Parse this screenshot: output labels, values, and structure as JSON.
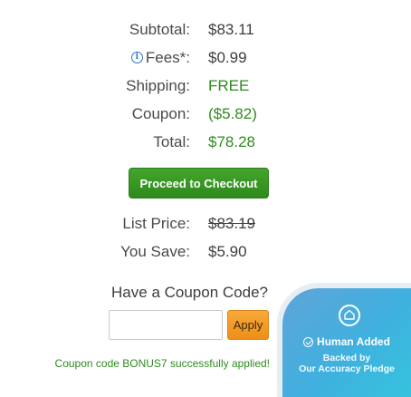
{
  "summary": {
    "subtotal": {
      "label": "Subtotal:",
      "value": "$83.11"
    },
    "fees": {
      "icon": "info-icon",
      "icon_glyph": "i",
      "label": "Fees*:",
      "value": "$0.99"
    },
    "shipping": {
      "label": "Shipping:",
      "value": "FREE"
    },
    "coupon": {
      "label": "Coupon:",
      "value": "($5.82)"
    },
    "total": {
      "label": "Total:",
      "value": "$78.28"
    }
  },
  "checkout": {
    "label": "Proceed to Checkout"
  },
  "pricing": {
    "list_price": {
      "label": "List Price:",
      "value": "$83.19"
    },
    "you_save": {
      "label": "You Save:",
      "value": "$5.90"
    }
  },
  "coupon_form": {
    "heading": "Have a Coupon Code?",
    "input_value": "",
    "apply_label": "Apply",
    "success_message": "Coupon code BONUS7 successfully applied!"
  },
  "badge": {
    "icon": "home-icon",
    "title": "Human Added",
    "line1": "Backed by",
    "line2": "Our Accuracy Pledge"
  },
  "colors": {
    "green_text": "#2e8b1f",
    "checkout_green": "#2e8a1c",
    "apply_orange": "#ee8f17",
    "badge_blue": "#3fb1df"
  }
}
